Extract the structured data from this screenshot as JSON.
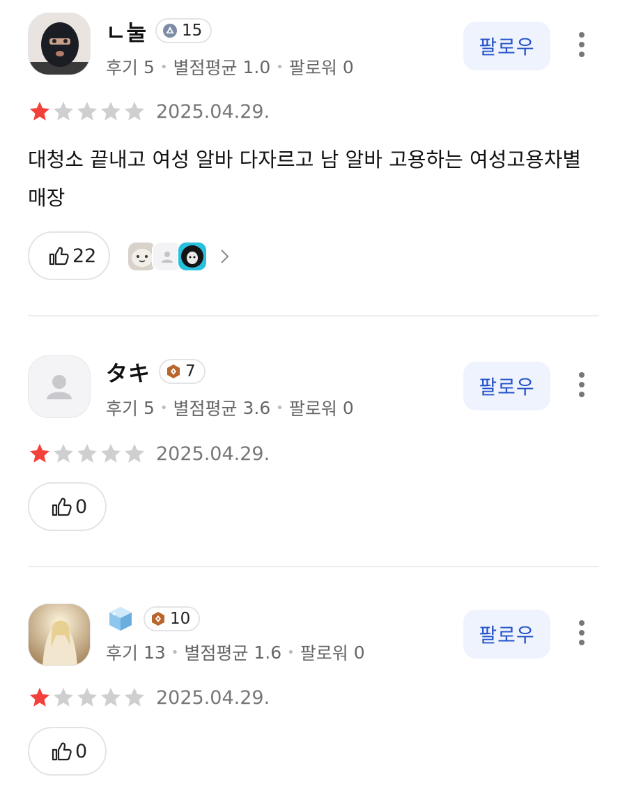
{
  "labels": {
    "follow": "팔로우",
    "reviews": "후기",
    "avg_rating": "별점평균",
    "followers": "팔로워"
  },
  "reviews": [
    {
      "username": "ㄴ눌",
      "level": "15",
      "level_icon": "triangle-badge-icon",
      "review_count": "5",
      "avg_rating": "1.0",
      "followers": "0",
      "rating": 1,
      "date": "2025.04.29.",
      "text": "대청소 끝내고 여성 알바 다자르고 남 알바 고용하는 여성고용차별 매장",
      "likes": "22",
      "liker_avatars": [
        "seal-avatar",
        "default-avatar",
        "anime-avatar"
      ]
    },
    {
      "username": "タキ",
      "level": "7",
      "level_icon": "bronze-hex-badge-icon",
      "review_count": "5",
      "avg_rating": "3.6",
      "followers": "0",
      "rating": 1,
      "date": "2025.04.29.",
      "likes": "0"
    },
    {
      "username": "",
      "username_icon": "ice-cube-icon",
      "level": "10",
      "level_icon": "bronze-hex-badge-icon",
      "review_count": "13",
      "avg_rating": "1.6",
      "followers": "0",
      "rating": 1,
      "date": "2025.04.29.",
      "likes": "0"
    }
  ],
  "colors": {
    "star_on": "#f2413b",
    "star_off": "#cfcfcf",
    "follow_text": "#2452c9",
    "follow_bg": "#eef3fd"
  }
}
